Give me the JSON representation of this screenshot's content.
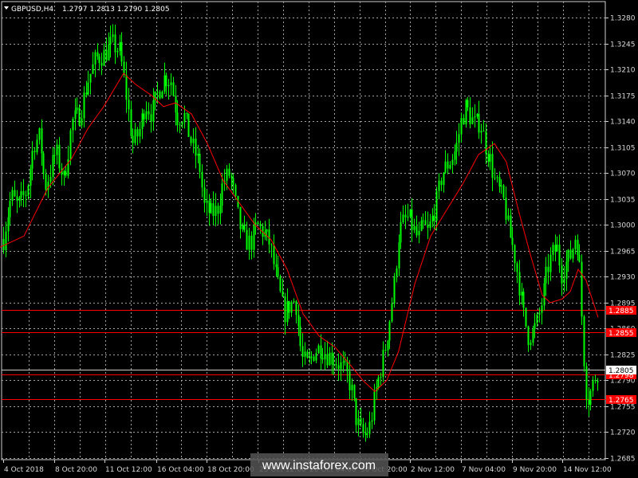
{
  "header": {
    "symbol": "GBPUSD,H4",
    "ohlc": "1.2797 1.2813 1.2790 1.2805"
  },
  "watermark": "www.instaforex.com",
  "colors": {
    "background": "#000000",
    "grid": "#a0a0a0",
    "candle": "#00ff00",
    "ma": "#ff0000",
    "level": "#ff0000",
    "current": "#c8c8c8"
  },
  "chart_data": {
    "type": "candlestick",
    "title": "",
    "ylim": [
      1.2685,
      1.329
    ],
    "y_ticks": [
      "1.3280",
      "1.3245",
      "1.3210",
      "1.3175",
      "1.3140",
      "1.3105",
      "1.3070",
      "1.3035",
      "1.3000",
      "1.2965",
      "1.2930",
      "1.2895",
      "1.2860",
      "1.2825",
      "1.2790",
      "1.2755",
      "1.2720",
      "1.2685"
    ],
    "x_ticks": [
      "4 Oct 2018",
      "8 Oct 20:00",
      "11 Oct 12:00",
      "16 Oct 04:00",
      "18 Oct 20:00",
      "23 Oct 12:00",
      "26 Oct 04:00",
      "30 Oct 20:00",
      "2 Nov 12:00",
      "7 Nov 04:00",
      "9 Nov 20:00",
      "14 Nov 12:00"
    ],
    "price_path": [
      [
        0,
        1.2945
      ],
      [
        5,
        1.299
      ],
      [
        14,
        1.304
      ],
      [
        22,
        1.3025
      ],
      [
        33,
        1.3045
      ],
      [
        42,
        1.311
      ],
      [
        50,
        1.312
      ],
      [
        56,
        1.305
      ],
      [
        62,
        1.307
      ],
      [
        70,
        1.31
      ],
      [
        80,
        1.306
      ],
      [
        90,
        1.314
      ],
      [
        100,
        1.315
      ],
      [
        110,
        1.3195
      ],
      [
        120,
        1.3225
      ],
      [
        130,
        1.323
      ],
      [
        140,
        1.3245
      ],
      [
        150,
        1.3235
      ],
      [
        158,
        1.3175
      ],
      [
        166,
        1.311
      ],
      [
        174,
        1.3125
      ],
      [
        182,
        1.3165
      ],
      [
        190,
        1.315
      ],
      [
        198,
        1.318
      ],
      [
        206,
        1.32
      ],
      [
        214,
        1.3195
      ],
      [
        222,
        1.3145
      ],
      [
        230,
        1.315
      ],
      [
        240,
        1.311
      ],
      [
        250,
        1.308
      ],
      [
        256,
        1.3025
      ],
      [
        264,
        1.3015
      ],
      [
        272,
        1.302
      ],
      [
        280,
        1.306
      ],
      [
        288,
        1.307
      ],
      [
        294,
        1.3035
      ],
      [
        300,
        1.3
      ],
      [
        306,
        1.298
      ],
      [
        314,
        1.2975
      ],
      [
        322,
        1.3
      ],
      [
        330,
        1.299
      ],
      [
        338,
        1.2975
      ],
      [
        344,
        1.294
      ],
      [
        350,
        1.291
      ],
      [
        356,
        1.288
      ],
      [
        362,
        1.289
      ],
      [
        370,
        1.29
      ],
      [
        378,
        1.282
      ],
      [
        386,
        1.281
      ],
      [
        394,
        1.283
      ],
      [
        402,
        1.2835
      ],
      [
        410,
        1.2825
      ],
      [
        418,
        1.282
      ],
      [
        426,
        1.281
      ],
      [
        434,
        1.28
      ],
      [
        440,
        1.278
      ],
      [
        446,
        1.274
      ],
      [
        452,
        1.272
      ],
      [
        458,
        1.2715
      ],
      [
        464,
        1.273
      ],
      [
        470,
        1.277
      ],
      [
        476,
        1.28
      ],
      [
        482,
        1.283
      ],
      [
        488,
        1.287
      ],
      [
        494,
        1.292
      ],
      [
        500,
        1.299
      ],
      [
        506,
        1.3005
      ],
      [
        512,
        1.301
      ],
      [
        518,
        1.2995
      ],
      [
        524,
        1.298
      ],
      [
        530,
        1.3
      ],
      [
        536,
        1.299
      ],
      [
        542,
        1.301
      ],
      [
        548,
        1.3035
      ],
      [
        554,
        1.307
      ],
      [
        560,
        1.308
      ],
      [
        566,
        1.309
      ],
      [
        572,
        1.3105
      ],
      [
        578,
        1.314
      ],
      [
        584,
        1.316
      ],
      [
        590,
        1.3145
      ],
      [
        596,
        1.3135
      ],
      [
        602,
        1.314
      ],
      [
        608,
        1.311
      ],
      [
        614,
        1.309
      ],
      [
        620,
        1.306
      ],
      [
        626,
        1.3045
      ],
      [
        632,
        1.303
      ],
      [
        638,
        1.299
      ],
      [
        644,
        1.2965
      ],
      [
        650,
        1.2925
      ],
      [
        656,
        1.288
      ],
      [
        662,
        1.285
      ],
      [
        668,
        1.2855
      ],
      [
        674,
        1.287
      ],
      [
        680,
        1.29
      ],
      [
        686,
        1.294
      ],
      [
        692,
        1.296
      ],
      [
        698,
        1.297
      ],
      [
        704,
        1.2935
      ],
      [
        710,
        1.295
      ],
      [
        716,
        1.296
      ],
      [
        722,
        1.299
      ],
      [
        726,
        1.295
      ],
      [
        730,
        1.286
      ],
      [
        734,
        1.278
      ],
      [
        738,
        1.2765
      ],
      [
        742,
        1.278
      ],
      [
        746,
        1.2795
      ],
      [
        750,
        1.2805
      ]
    ],
    "moving_average": [
      [
        0,
        1.297
      ],
      [
        30,
        1.2985
      ],
      [
        60,
        1.305
      ],
      [
        90,
        1.309
      ],
      [
        110,
        1.313
      ],
      [
        130,
        1.316
      ],
      [
        155,
        1.3205
      ],
      [
        170,
        1.319
      ],
      [
        190,
        1.3175
      ],
      [
        205,
        1.316
      ],
      [
        220,
        1.3165
      ],
      [
        240,
        1.315
      ],
      [
        260,
        1.311
      ],
      [
        280,
        1.306
      ],
      [
        300,
        1.303
      ],
      [
        320,
        1.3
      ],
      [
        340,
        1.298
      ],
      [
        360,
        1.294
      ],
      [
        380,
        1.288
      ],
      [
        400,
        1.285
      ],
      [
        420,
        1.2835
      ],
      [
        440,
        1.281
      ],
      [
        455,
        1.279
      ],
      [
        470,
        1.2775
      ],
      [
        485,
        1.279
      ],
      [
        500,
        1.283
      ],
      [
        520,
        1.292
      ],
      [
        540,
        1.2985
      ],
      [
        560,
        1.302
      ],
      [
        580,
        1.3055
      ],
      [
        600,
        1.3095
      ],
      [
        620,
        1.311
      ],
      [
        635,
        1.3085
      ],
      [
        650,
        1.302
      ],
      [
        665,
        1.296
      ],
      [
        680,
        1.2905
      ],
      [
        690,
        1.2895
      ],
      [
        705,
        1.29
      ],
      [
        715,
        1.291
      ],
      [
        725,
        1.294
      ],
      [
        735,
        1.2925
      ],
      [
        750,
        1.2875
      ]
    ],
    "levels": [
      {
        "label": "1.2885",
        "value": 1.2885
      },
      {
        "label": "1.2855",
        "value": 1.2855
      },
      {
        "label": "1.2798",
        "value": 1.2798
      },
      {
        "label": "1.2765",
        "value": 1.2765
      }
    ],
    "current_price": {
      "label": "1.2805",
      "value": 1.2805
    }
  }
}
